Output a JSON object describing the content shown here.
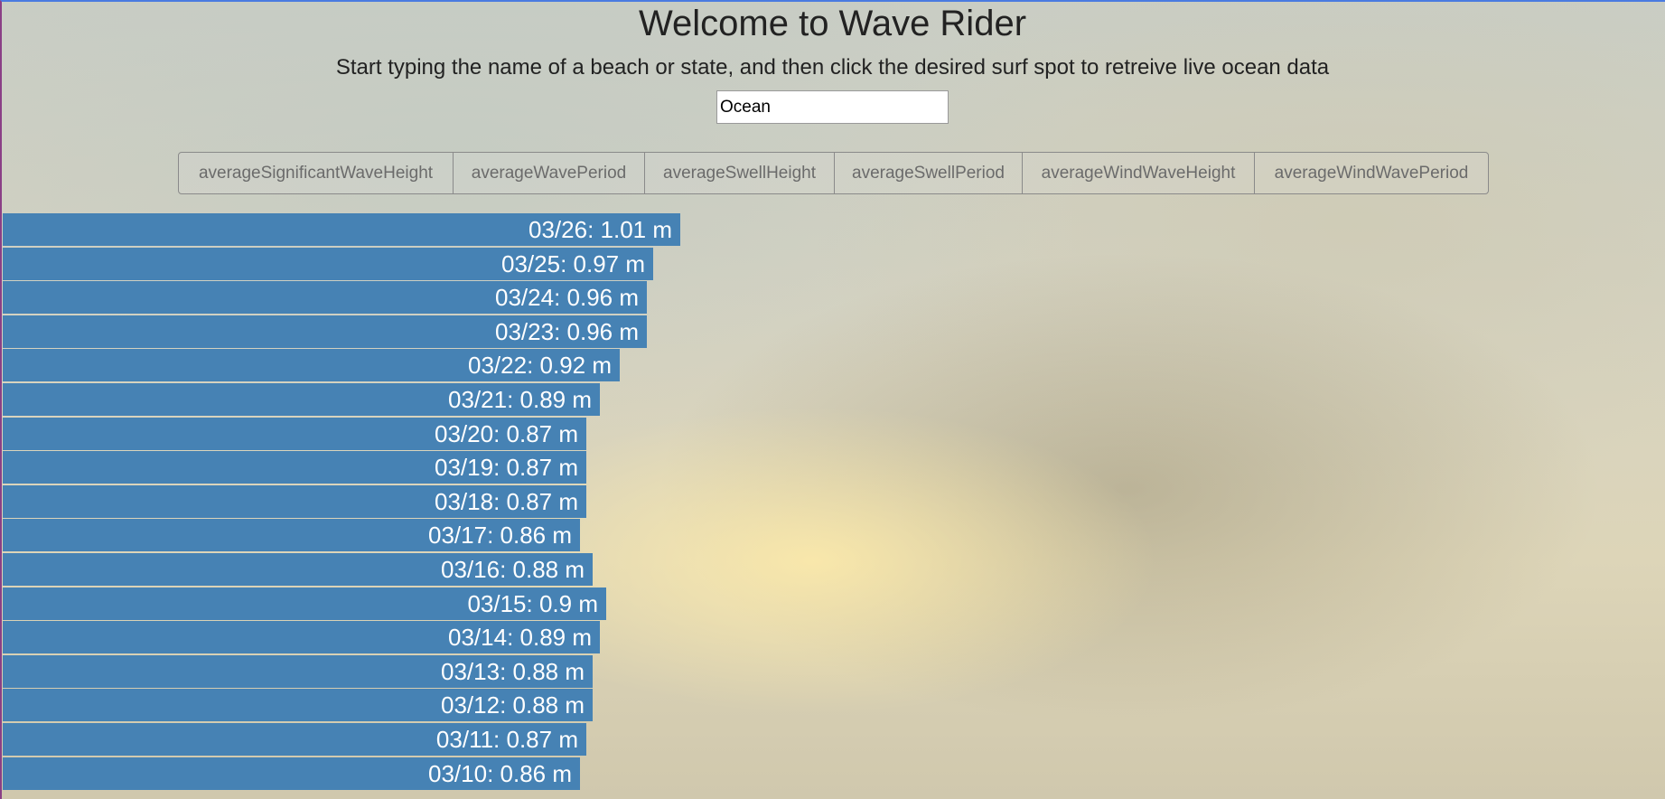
{
  "header": {
    "title": "Welcome to Wave Rider",
    "subtitle": "Start typing the name of a beach or state, and then click the desired surf spot to retreive live ocean data"
  },
  "search": {
    "value": "Ocean"
  },
  "tabs": [
    {
      "label": "averageSignificantWaveHeight"
    },
    {
      "label": "averageWavePeriod"
    },
    {
      "label": "averageSwellHeight"
    },
    {
      "label": "averageSwellPeriod"
    },
    {
      "label": "averageWindWaveHeight"
    },
    {
      "label": "averageWindWavePeriod"
    }
  ],
  "colors": {
    "bar": "#4682b4",
    "bar_text": "#ffffff"
  },
  "chart_data": {
    "type": "bar",
    "orientation": "horizontal",
    "unit": "m",
    "categories": [
      "03/26",
      "03/25",
      "03/24",
      "03/23",
      "03/22",
      "03/21",
      "03/20",
      "03/19",
      "03/18",
      "03/17",
      "03/16",
      "03/15",
      "03/14",
      "03/13",
      "03/12",
      "03/11",
      "03/10"
    ],
    "values": [
      1.01,
      0.97,
      0.96,
      0.96,
      0.92,
      0.89,
      0.87,
      0.87,
      0.87,
      0.86,
      0.88,
      0.9,
      0.89,
      0.88,
      0.88,
      0.87,
      0.86
    ],
    "labels": [
      "03/26: 1.01 m",
      "03/25: 0.97 m",
      "03/24: 0.96 m",
      "03/23: 0.96 m",
      "03/22: 0.92 m",
      "03/21: 0.89 m",
      "03/20: 0.87 m",
      "03/19: 0.87 m",
      "03/18: 0.87 m",
      "03/17: 0.86 m",
      "03/16: 0.88 m",
      "03/15: 0.9 m",
      "03/14: 0.89 m",
      "03/13: 0.88 m",
      "03/12: 0.88 m",
      "03/11: 0.87 m",
      "03/10: 0.86 m"
    ]
  }
}
